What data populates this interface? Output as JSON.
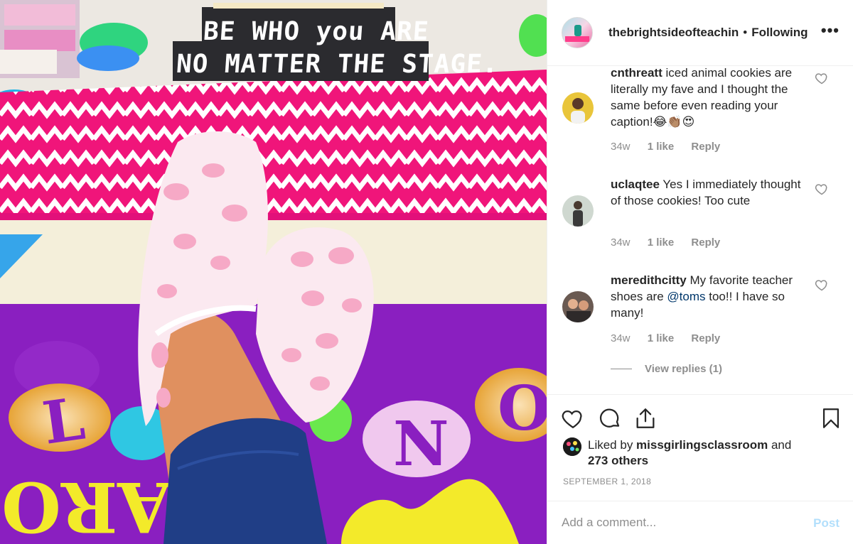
{
  "photo": {
    "sign_line1": "BE WHO you ARE",
    "sign_line2": "NO MATTER THE STAGE.",
    "floor_letters": [
      "L",
      "N",
      "O"
    ],
    "floor_text_left": "ARO",
    "colors": {
      "rug_pink": "#f0157a",
      "floor_purple": "#8a1fc0",
      "accent_yellow": "#f3ea2a"
    }
  },
  "header": {
    "username": "thebrightsideofteachin",
    "separator": "•",
    "follow_status": "Following",
    "more_icon": "more-horizontal-icon"
  },
  "comments": [
    {
      "username": "cnthreatt",
      "text": "iced animal cookies are literally my fave and I thought the same before even reading your caption!😂👏🏽😍",
      "time": "34w",
      "likes": "1 like",
      "reply": "Reply"
    },
    {
      "username": "uclaqtee",
      "text": "Yes I immediately thought of those cookies! Too cute",
      "time": "34w",
      "likes": "1 like",
      "reply": "Reply"
    },
    {
      "username": "meredithcitty",
      "text_before": "My favorite teacher shoes are ",
      "mention": "@toms",
      "text_after": " too!! I have so many!",
      "time": "34w",
      "likes": "1 like",
      "reply": "Reply"
    }
  ],
  "view_replies": "View replies (1)",
  "actions": {
    "icons": [
      "heart-icon",
      "comment-icon",
      "share-icon",
      "bookmark-icon"
    ]
  },
  "likes": {
    "prefix": "Liked by ",
    "user": "missgirlingsclassroom",
    "middle": " and",
    "others": "273 others"
  },
  "date": "SEPTEMBER 1, 2018",
  "add_comment": {
    "placeholder": "Add a comment...",
    "post_label": "Post",
    "post_color": "#b2dffc"
  }
}
